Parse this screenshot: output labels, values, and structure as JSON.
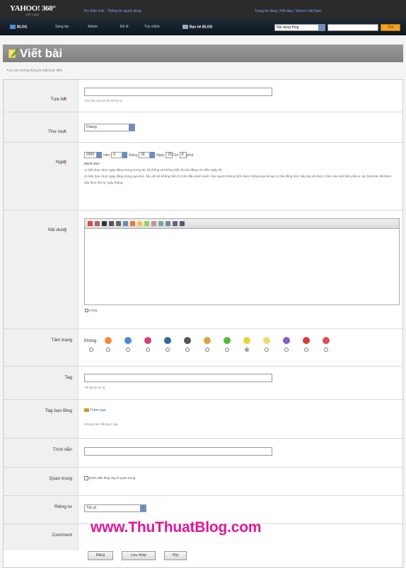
{
  "header": {
    "logo": "YAHOO! 360°",
    "logo_sub": "VIỆT NAM",
    "message": "Tin nhắn mới · Thông tin người dùng",
    "right_links": "Trang tin dùng | Hỏi đáp | Yahoo! Việt Nam"
  },
  "nav": {
    "blog": "BLOG",
    "items": [
      "Sáng tác",
      "Admin",
      "Đồ lề",
      "Tùy chỉnh"
    ],
    "friends_blog": "Bạn bè BLOG",
    "search_select": "Nội dung Blog",
    "search_button": "Tìm"
  },
  "page": {
    "title": "Viết bài",
    "required_note": "Là các trường thông tin bắt buộc điền"
  },
  "form": {
    "title_label": "Tựa bài",
    "title_hint": "Tựa bài còn 64 đủ 80 ký tự",
    "folder_label": "Thư mục",
    "folder_value": "Chung",
    "date_label": "Ngày",
    "year": "2009",
    "year_label": "năm",
    "month": "4",
    "month_label": "tháng",
    "day": "29",
    "day_label": "Ngày",
    "hour": "22",
    "hour_label": "Giờ",
    "minute": "8",
    "minute_label": "phút",
    "date_help_title": "Mách nhỏ:",
    "date_help_1": "1) Nếu bạn chọn ngày đăng trong tương lai, hệ thống sẽ không hiển thị bài đăng cho đến ngày đó.",
    "date_help_2": "2) Nếu bạn chọn ngày đăng trong quá khứ, bài viết sẽ không hiển thị trên đầu danh sách. Mọi người không nhìn được thông báo là bạn có bài đăng mới. Bài này sẽ được chèn vào một bên phải ví các bài khác đã được sắp theo thứ tự ngày tháng.",
    "content_label": "Nội dung",
    "html_label": "HTML",
    "mood_label": "Tâm trạng",
    "mood_none": "Không",
    "tag_label": "Tag",
    "tag_hint": "Tối đa 50 ký tự",
    "friend_tag_label": "Tag bạn Blog",
    "add_friend": "Thêm bạn",
    "friend_none": "Không bạn đã được tag",
    "quote_label": "Trích dẫn",
    "important_label": "Quan trọng",
    "important_check": "Đánh dấu blog này là quan trọng",
    "privacy_label": "Riêng tư",
    "privacy_value": "Tất cả",
    "comment_label": "Comment"
  },
  "buttons": {
    "publish": "Đăng",
    "save_draft": "Lưu nháp",
    "cancel": "Hủy"
  },
  "watermark": "www.ThuThuatBlog.com",
  "colors": {
    "header_bg": "#2b2b2b",
    "title_bar": "#8a8a8a",
    "watermark": "#e0179b",
    "search_button": "#f4a21d"
  }
}
